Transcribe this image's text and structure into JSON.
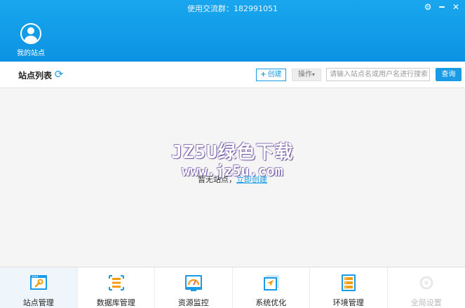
{
  "header": {
    "qq_group": "使用交流群：182991051",
    "my_site_label": "我的站点"
  },
  "toolbar": {
    "title": "站点列表",
    "create_label": "创建",
    "ops_label": "操作",
    "search_placeholder": "请输入站点名或用户名进行搜索",
    "search_button": "查询"
  },
  "main": {
    "watermark_line1": "JZ5U绿色下载",
    "watermark_line2": "www.jz5u.com",
    "empty_text": "暂无站点，",
    "empty_link": "立即创建"
  },
  "bottom_tabs": [
    {
      "label": "站点管理",
      "icon": "wrench-monitor-icon"
    },
    {
      "label": "数据库管理",
      "icon": "database-icon"
    },
    {
      "label": "资源监控",
      "icon": "gauge-monitor-icon"
    },
    {
      "label": "系统优化",
      "icon": "arrow-cursor-icon"
    },
    {
      "label": "环境管理",
      "icon": "server-rack-icon"
    },
    {
      "label": "全局设置",
      "icon": "settings-icon"
    }
  ],
  "colors": {
    "header_blue": "#0b93e3",
    "accent": "#1a9be6"
  }
}
